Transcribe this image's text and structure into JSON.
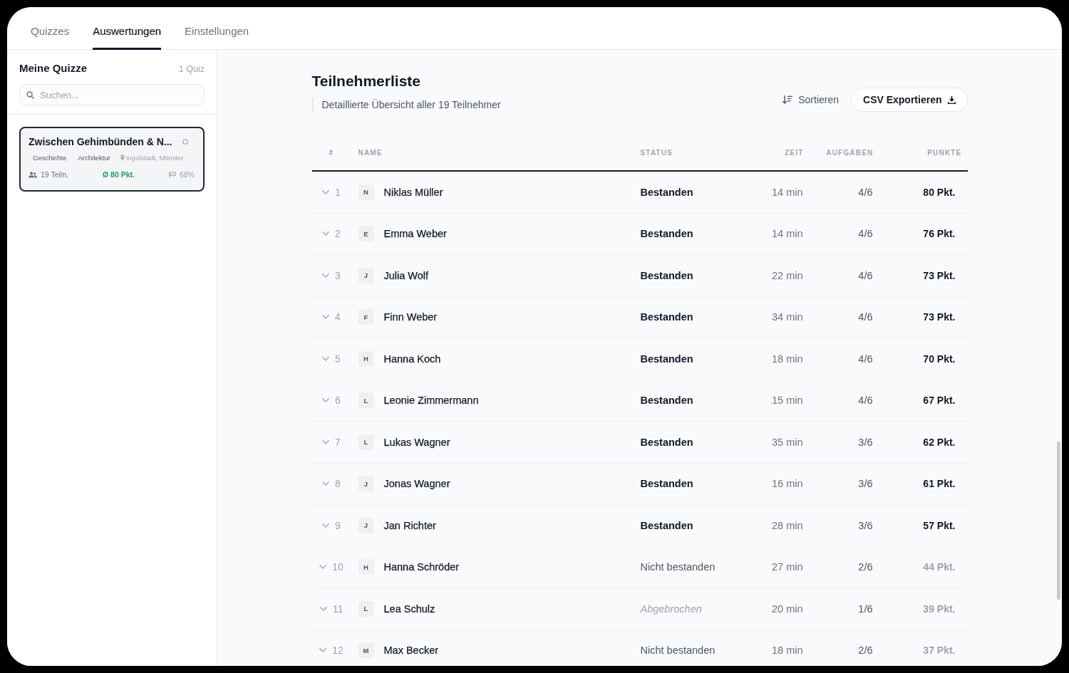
{
  "tabs": [
    {
      "label": "Quizzes",
      "selected": false
    },
    {
      "label": "Auswertungen",
      "selected": true
    },
    {
      "label": "Einstellungen",
      "selected": false
    }
  ],
  "sidebar": {
    "title": "Meine Quizze",
    "count": "1 Quiz",
    "search": {
      "placeholder": "Suchen..."
    },
    "quizzes": [
      {
        "title": "Zwischen Gehimbünden & N...",
        "selected": true,
        "tags": [
          {
            "label": "Geschichte",
            "kind": "tag"
          },
          {
            "label": "Architektur",
            "kind": "tag"
          },
          {
            "label": "Ingolstadt, Münster",
            "kind": "location"
          }
        ],
        "stats": [
          {
            "label": "19 Teiln.",
            "kind": "participants"
          },
          {
            "label": "Ø 80 Pkt.",
            "kind": "average"
          },
          {
            "label": "68%",
            "kind": "completion"
          }
        ]
      }
    ]
  },
  "main": {
    "title": "Teilnehmerliste",
    "subtitle": "Detaillierte Übersicht aller 19 Teilnehmer",
    "sort_button": "Sortieren",
    "export_button": "CSV Exportieren",
    "table": {
      "columns": [
        "#",
        "NAME",
        "STATUS",
        "ZEIT",
        "AUFGABEN",
        "PUNKTE"
      ],
      "rows": [
        {
          "number": "1",
          "initial": "N",
          "name": "Niklas Müller",
          "status": "Bestanden",
          "kind": "passed",
          "time": "14 min",
          "tasks": "4/6",
          "points": "80 Pkt."
        },
        {
          "number": "2",
          "initial": "E",
          "name": "Emma Weber",
          "status": "Bestanden",
          "kind": "passed",
          "time": "14 min",
          "tasks": "4/6",
          "points": "76 Pkt."
        },
        {
          "number": "3",
          "initial": "J",
          "name": "Julia Wolf",
          "status": "Bestanden",
          "kind": "passed",
          "time": "22 min",
          "tasks": "4/6",
          "points": "73 Pkt."
        },
        {
          "number": "4",
          "initial": "F",
          "name": "Finn Weber",
          "status": "Bestanden",
          "kind": "passed",
          "time": "34 min",
          "tasks": "4/6",
          "points": "73 Pkt."
        },
        {
          "number": "5",
          "initial": "H",
          "name": "Hanna Koch",
          "status": "Bestanden",
          "kind": "passed",
          "time": "18 min",
          "tasks": "4/6",
          "points": "70 Pkt."
        },
        {
          "number": "6",
          "initial": "L",
          "name": "Leonie Zimmermann",
          "status": "Bestanden",
          "kind": "passed",
          "time": "15 min",
          "tasks": "4/6",
          "points": "67 Pkt."
        },
        {
          "number": "7",
          "initial": "L",
          "name": "Lukas Wagner",
          "status": "Bestanden",
          "kind": "passed",
          "time": "35 min",
          "tasks": "3/6",
          "points": "62 Pkt."
        },
        {
          "number": "8",
          "initial": "J",
          "name": "Jonas Wagner",
          "status": "Bestanden",
          "kind": "passed",
          "time": "16 min",
          "tasks": "3/6",
          "points": "61 Pkt."
        },
        {
          "number": "9",
          "initial": "J",
          "name": "Jan Richter",
          "status": "Bestanden",
          "kind": "passed",
          "time": "28 min",
          "tasks": "3/6",
          "points": "57 Pkt."
        },
        {
          "number": "10",
          "initial": "H",
          "name": "Hanna Schröder",
          "status": "Nicht bestanden",
          "kind": "failed",
          "time": "27 min",
          "tasks": "2/6",
          "points": "44 Pkt."
        },
        {
          "number": "11",
          "initial": "L",
          "name": "Lea Schulz",
          "status": "Abgebrochen",
          "kind": "aborted",
          "time": "20 min",
          "tasks": "1/6",
          "points": "39 Pkt."
        },
        {
          "number": "12",
          "initial": "M",
          "name": "Max Becker",
          "status": "Nicht bestanden",
          "kind": "failed",
          "time": "18 min",
          "tasks": "2/6",
          "points": "37 Pkt."
        }
      ]
    }
  }
}
